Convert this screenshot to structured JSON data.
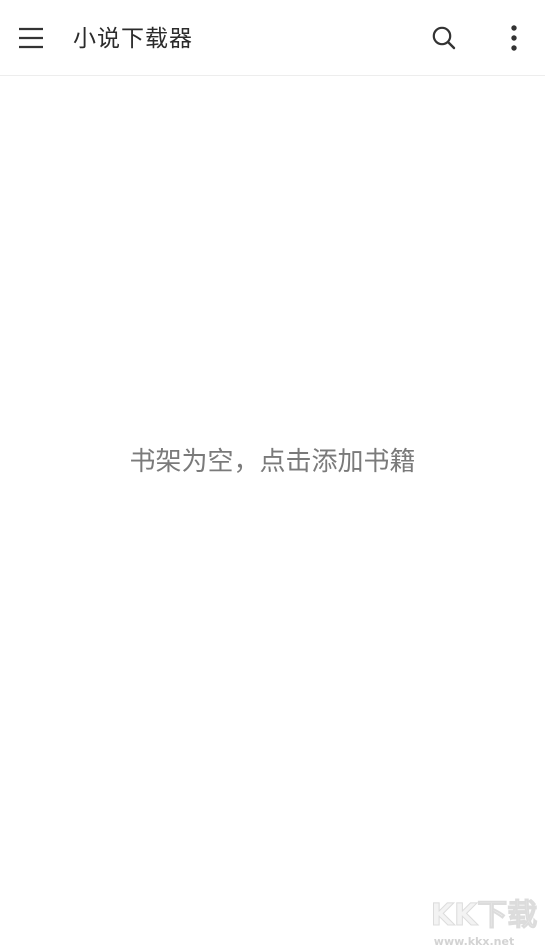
{
  "appbar": {
    "title": "小说下载器",
    "menu_icon": "menu-icon",
    "search_icon": "search-icon",
    "more_icon": "more-vertical-icon"
  },
  "shelf": {
    "empty_message": "书架为空，点击添加书籍"
  },
  "watermark": {
    "logo_text": "KK下载",
    "url_text": "www.kkx.net"
  },
  "colors": {
    "background": "#ffffff",
    "title_text": "#2b2b2b",
    "empty_text": "#7a7a7a",
    "icon": "#333333",
    "divider": "#ededed"
  }
}
